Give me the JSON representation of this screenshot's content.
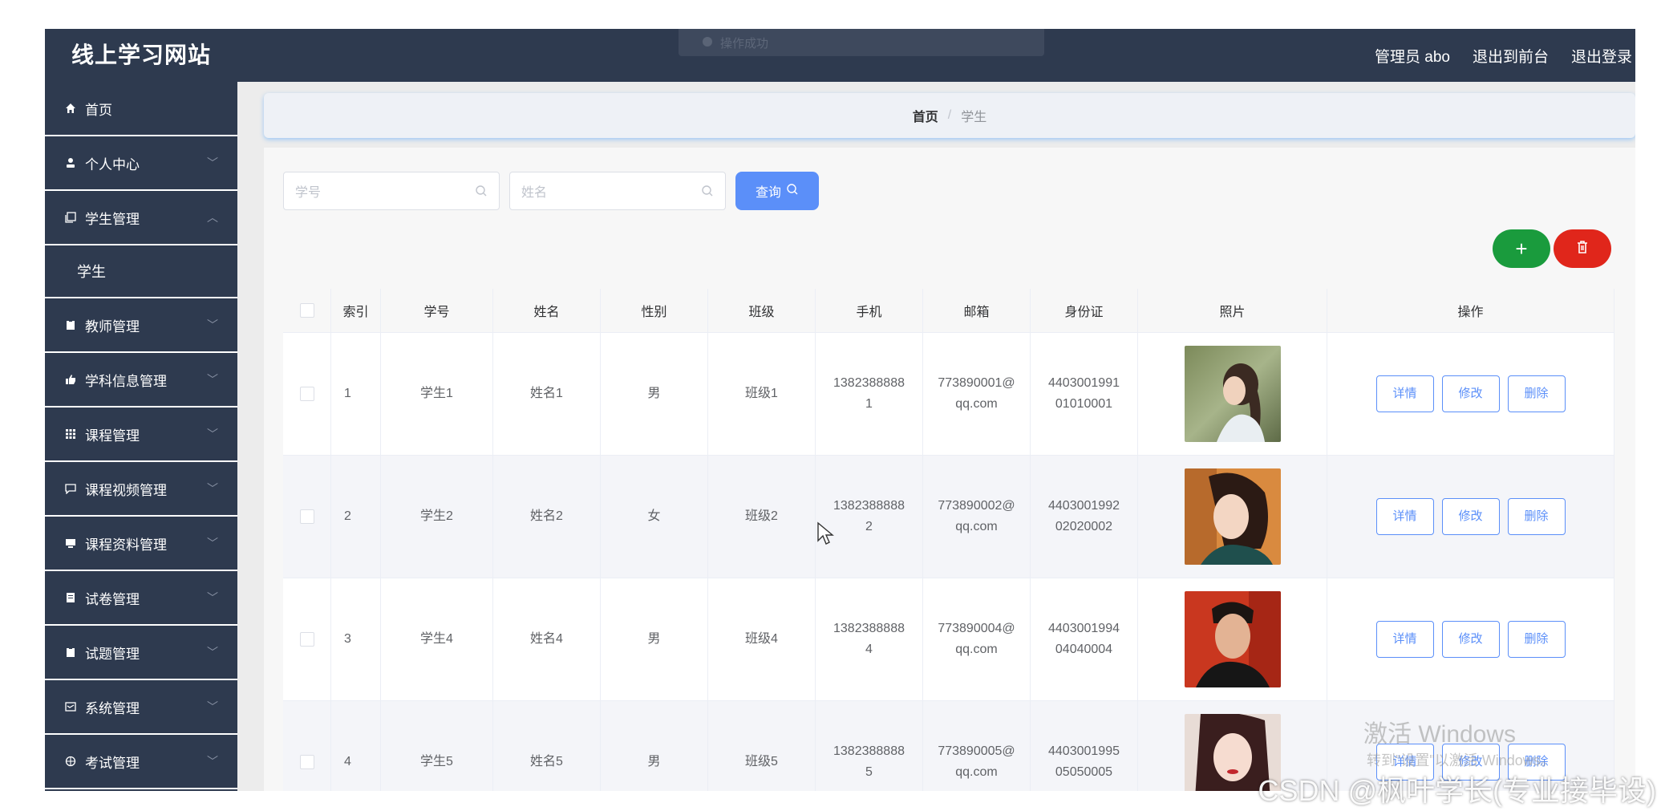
{
  "app": {
    "title": "线上学习网站",
    "toast": "操作成功",
    "topnav": [
      "管理员 abo",
      "退出到前台",
      "退出登录"
    ]
  },
  "sidebar": {
    "items": [
      {
        "label": "首页",
        "icon": "home-icon",
        "arrow": ""
      },
      {
        "label": "个人中心",
        "icon": "user-icon",
        "arrow": "﹀"
      },
      {
        "label": "学生管理",
        "icon": "copy-icon",
        "arrow": "︿"
      },
      {
        "label": "教师管理",
        "icon": "clipboard-icon",
        "arrow": "﹀"
      },
      {
        "label": "学科信息管理",
        "icon": "thumb-icon",
        "arrow": "﹀"
      },
      {
        "label": "课程管理",
        "icon": "grid-icon",
        "arrow": "﹀"
      },
      {
        "label": "课程视频管理",
        "icon": "chat-icon",
        "arrow": "﹀"
      },
      {
        "label": "课程资料管理",
        "icon": "monitor-icon",
        "arrow": "﹀"
      },
      {
        "label": "试卷管理",
        "icon": "book-icon",
        "arrow": "﹀"
      },
      {
        "label": "试题管理",
        "icon": "clipboard-icon",
        "arrow": "﹀"
      },
      {
        "label": "系统管理",
        "icon": "mail-icon",
        "arrow": "﹀"
      },
      {
        "label": "考试管理",
        "icon": "target-icon",
        "arrow": "﹀"
      }
    ],
    "submenu": {
      "label": "学生"
    }
  },
  "breadcrumb": {
    "home": "首页",
    "separator": "/",
    "current": "学生"
  },
  "search": {
    "student_no_placeholder": "学号",
    "name_placeholder": "姓名",
    "query_label": "查询"
  },
  "actions": {
    "add": "+"
  },
  "table": {
    "headers": [
      "索引",
      "学号",
      "姓名",
      "性别",
      "班级",
      "手机",
      "邮箱",
      "身份证",
      "照片",
      "操作"
    ],
    "rows": [
      {
        "index": "1",
        "student_no": "学生1",
        "name": "姓名1",
        "gender": "男",
        "class": "班级1",
        "phone_a": "1382388888",
        "phone_b": "1",
        "email_a": "773890001@",
        "email_b": "qq.com",
        "id_a": "4403001991",
        "id_b": "01010001",
        "photo": "woman-profile-photo"
      },
      {
        "index": "2",
        "student_no": "学生2",
        "name": "姓名2",
        "gender": "女",
        "class": "班级2",
        "phone_a": "1382388888",
        "phone_b": "2",
        "email_a": "773890002@",
        "email_b": "qq.com",
        "id_a": "4403001992",
        "id_b": "02020002",
        "photo": "woman-portrait-photo"
      },
      {
        "index": "3",
        "student_no": "学生4",
        "name": "姓名4",
        "gender": "男",
        "class": "班级4",
        "phone_a": "1382388888",
        "phone_b": "4",
        "email_a": "773890004@",
        "email_b": "qq.com",
        "id_a": "4403001994",
        "id_b": "04040004",
        "photo": "man-portrait-photo"
      },
      {
        "index": "4",
        "student_no": "学生5",
        "name": "姓名5",
        "gender": "男",
        "class": "班级5",
        "phone_a": "1382388888",
        "phone_b": "5",
        "email_a": "773890005@",
        "email_b": "qq.com",
        "id_a": "4403001995",
        "id_b": "05050005",
        "photo": "woman-red-lips-photo"
      }
    ],
    "row_actions": {
      "detail": "详情",
      "edit": "修改",
      "delete": "删除"
    }
  },
  "overlay": {
    "activate_title": "激活 Windows",
    "activate_sub": "转到\"设置\"以激活 Windows。",
    "csdn": "CSDN @枫叶学长(专业接毕设)"
  },
  "colors": {
    "sidebar_bg": "#2e3a4f",
    "primary": "#5b8ff9",
    "add_green": "#1a9b3d",
    "delete_red": "#e0261b"
  }
}
